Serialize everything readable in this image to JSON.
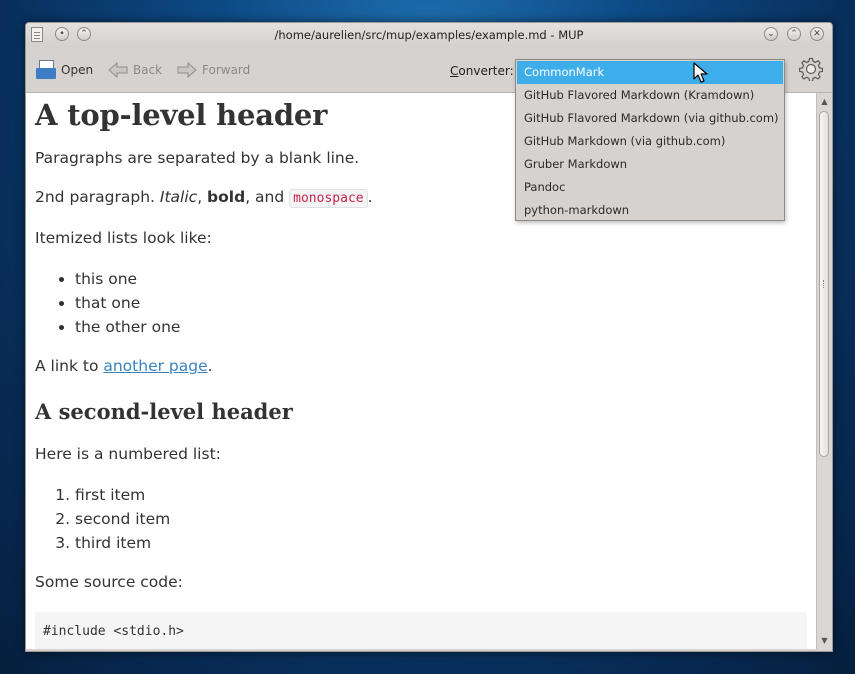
{
  "window": {
    "title": "/home/aurelien/src/mup/examples/example.md - MUP"
  },
  "toolbar": {
    "open_label": "Open",
    "back_label": "Back",
    "forward_label": "Forward",
    "converter_label_underlined": "C",
    "converter_label_rest": "onverter:"
  },
  "converter_menu": {
    "selected": "CommonMark",
    "options": [
      "CommonMark",
      "GitHub Flavored Markdown (Kramdown)",
      "GitHub Flavored Markdown (via github.com)",
      "GitHub Markdown (via github.com)",
      "Gruber Markdown",
      "Pandoc",
      "python-markdown"
    ]
  },
  "document": {
    "h1": "A top-level header",
    "p1": "Paragraphs are separated by a blank line.",
    "p2_pre": "2nd paragraph. ",
    "p2_italic": "Italic",
    "p2_sep1": ", ",
    "p2_bold": "bold",
    "p2_sep2": ", and ",
    "p2_code": "monospace",
    "p2_end": ".",
    "p3": "Itemized lists look like:",
    "bullets": [
      "this one",
      "that one",
      "the other one"
    ],
    "p4_pre": "A link to ",
    "p4_link": "another page",
    "p4_end": ".",
    "h2": "A second-level header",
    "p5": "Here is a numbered list:",
    "numbered": [
      "first item",
      "second item",
      "third item"
    ],
    "p6": "Some source code:",
    "code_line": "#include <stdio.h>"
  },
  "colors": {
    "selection": "#3daee9",
    "link": "#3a83c0",
    "inline_code": "#c7254e",
    "window_bg": "#d6d2d0"
  }
}
